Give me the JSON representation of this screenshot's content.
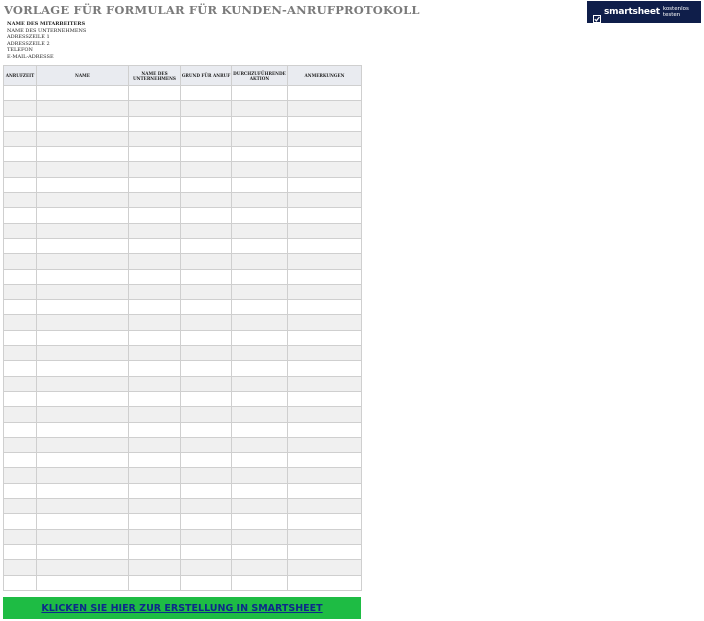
{
  "title": "VORLAGE FÜR FORMULAR FÜR KUNDEN-ANRUFPROTOKOLL",
  "brand": {
    "name": "smartsheet",
    "cta": "kostenlos testen",
    "bg_color": "#0f1e4a"
  },
  "info": {
    "employee_label": "NAME DES MITARBEITERS",
    "company": "NAME DES UNTERNEHMENS",
    "address1": "ADRESSZEILE 1",
    "address2": "ADRESSZEILE 2",
    "phone": "TELEFON",
    "email": "E-MAIL-ADRESSE"
  },
  "table": {
    "headers": [
      "ANRUFZEIT",
      "NAME",
      "NAME DES UNTERNEHMENS",
      "GRUND FÜR ANRUF",
      "DURCHZUFÜHRENDE AKTION",
      "ANMERKUNGEN"
    ],
    "row_count": 33
  },
  "cta": {
    "label": "KLICKEN SIE HIER ZUR ERSTELLUNG IN SMARTSHEET",
    "bg_color": "#1ebc44"
  }
}
